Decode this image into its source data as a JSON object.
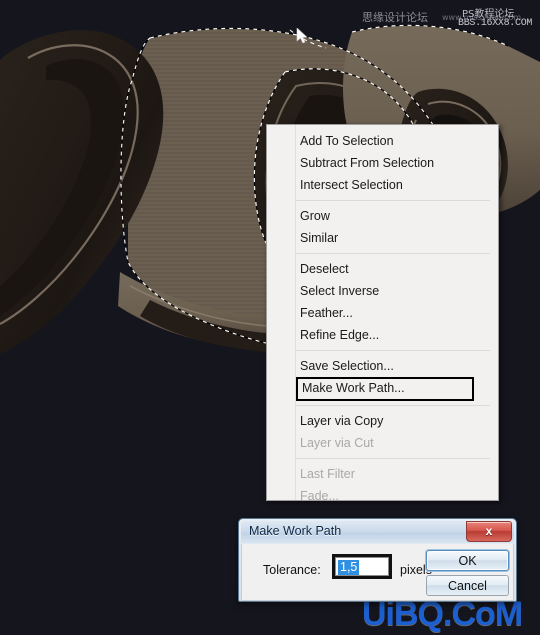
{
  "app": {
    "background_color": "#16161f",
    "artwork_fill": "#6b5f50",
    "artwork_shadow": "#241c16"
  },
  "cursor": {
    "name": "arrow-cursor"
  },
  "watermarks": {
    "cn_left": "思缘设计论坛",
    "www": "www.missyuan.com",
    "cn_right": "PS教程论坛",
    "bbs": "BBS.16XX8.COM",
    "uibq": "UiBQ.CoM",
    "uibq_color": "#1c5fd0"
  },
  "context_menu": {
    "groups": [
      {
        "items": [
          {
            "label": "Add To Selection",
            "disabled": false,
            "highlighted": false
          },
          {
            "label": "Subtract From Selection",
            "disabled": false,
            "highlighted": false
          },
          {
            "label": "Intersect Selection",
            "disabled": false,
            "highlighted": false
          }
        ]
      },
      {
        "items": [
          {
            "label": "Grow",
            "disabled": false,
            "highlighted": false
          },
          {
            "label": "Similar",
            "disabled": false,
            "highlighted": false
          }
        ]
      },
      {
        "items": [
          {
            "label": "Deselect",
            "disabled": false,
            "highlighted": false
          },
          {
            "label": "Select Inverse",
            "disabled": false,
            "highlighted": false
          },
          {
            "label": "Feather...",
            "disabled": false,
            "highlighted": false
          },
          {
            "label": "Refine Edge...",
            "disabled": false,
            "highlighted": false
          }
        ]
      },
      {
        "items": [
          {
            "label": "Save Selection...",
            "disabled": false,
            "highlighted": false
          },
          {
            "label": "Make Work Path...",
            "disabled": false,
            "highlighted": true
          }
        ]
      },
      {
        "items": [
          {
            "label": "Layer via Copy",
            "disabled": false,
            "highlighted": false
          },
          {
            "label": "Layer via Cut",
            "disabled": true,
            "highlighted": false
          }
        ]
      },
      {
        "items": [
          {
            "label": "Last Filter",
            "disabled": true,
            "highlighted": false
          },
          {
            "label": "Fade...",
            "disabled": true,
            "highlighted": false
          }
        ]
      }
    ]
  },
  "dialog": {
    "title": "Make Work Path",
    "close_glyph": "x",
    "tolerance_label": "Tolerance:",
    "tolerance_value": "1,5",
    "tolerance_units": "pixels",
    "selection_color": "#2f8fe0",
    "ok_label": "OK",
    "cancel_label": "Cancel"
  }
}
